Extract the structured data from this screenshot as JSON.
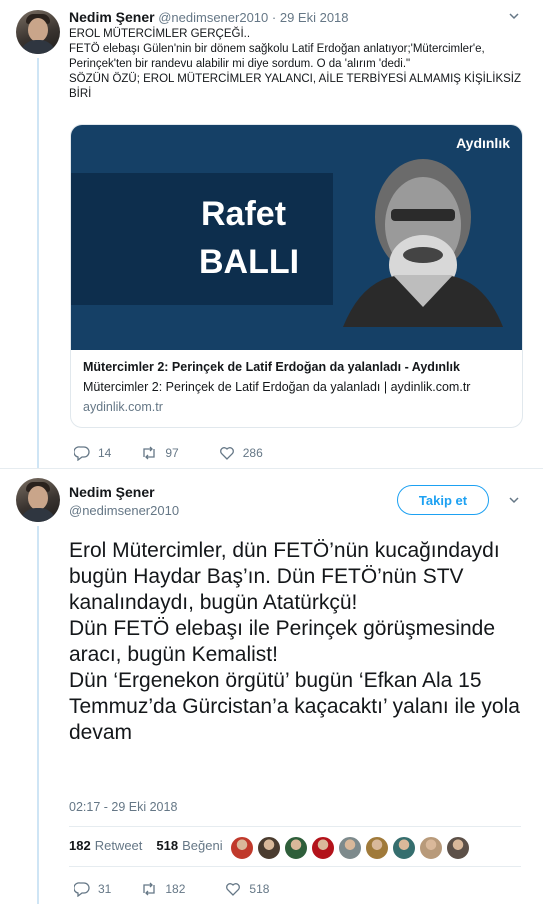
{
  "tweet1": {
    "name": "Nedim Şener",
    "handle": "@nedimsener2010",
    "date": "29 Eki 2018",
    "text_lines": [
      "EROL MÜTERCİMLER GERÇEĞİ..",
      "FETÖ elebaşı Gülen'nin bir dönem sağkolu Latif Erdoğan anlatıyor;'Mütercimler'e, Perinçek'ten bir randevu alabilir mi diye sordum. O da 'alırım 'dedi.\"",
      "SÖZÜN ÖZÜ; EROL MÜTERCİMLER YALANCI, AİLE TERBİYESİ ALMAMIŞ KİŞİLİKSİZ BİRİ"
    ],
    "card": {
      "brand": "Aydınlık",
      "image_title_line1": "Rafet",
      "image_title_line2": "BALLI",
      "title": "Mütercimler 2: Perinçek de Latif Erdoğan da yalanladı - Aydınlık",
      "description": "Mütercimler 2: Perinçek de Latif Erdoğan da yalanladı | aydinlik.com.tr",
      "domain": "aydinlik.com.tr"
    },
    "replies": "14",
    "retweets": "97",
    "likes": "286"
  },
  "tweet2": {
    "name": "Nedim Şener",
    "handle": "@nedimsener2010",
    "follow_label": "Takip et",
    "text_lines": [
      "Erol Mütercimler, dün FETÖ’nün kucağındaydı bugün Haydar Baş’ın. Dün FETÖ’nün STV kanalındaydı, bugün Atatürkçü!",
      "Dün FETÖ elebaşı ile Perinçek görüşmesinde aracı, bugün Kemalist!",
      "Dün ‘Ergenekon örgütü’ bugün ‘Efkan Ala 15 Temmuz’da Gürcistan’a kaçacaktı’ yalanı ile yola devam"
    ],
    "timestamp": "02:17 - 29 Eki 2018",
    "retweet_count": "182",
    "retweet_label": "Retweet",
    "like_count": "518",
    "like_label": "Beğeni",
    "likers": [
      "#c0392b",
      "#4a3b2f",
      "#2e5e3a",
      "#b3121a",
      "#7d8a8c",
      "#a07a3a",
      "#356e6e",
      "#b89a7a",
      "#5c5048"
    ],
    "replies": "31",
    "retweets": "182",
    "likes": "518"
  },
  "colors": {
    "accent": "#1da1f2",
    "muted": "#657786",
    "thread_line": "#cfe5f5"
  },
  "icons": [
    "chevron-down-icon",
    "reply-icon",
    "retweet-icon",
    "heart-icon"
  ]
}
